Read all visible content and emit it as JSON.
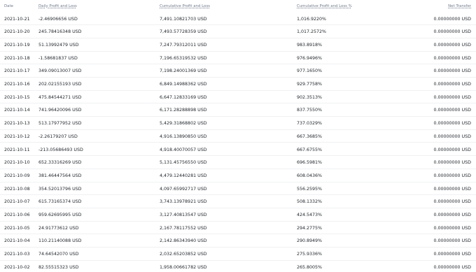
{
  "columns": {
    "date": "Date",
    "daily_pnl": "Daily Profit and Loss",
    "cumulative_pnl": "Cumulative Profit and Loss",
    "cumulative_pnl_pct": "Cumulative Profit and Loss %",
    "net_transfer": "Net Transfer"
  },
  "rows": [
    {
      "date": "2021-10-21",
      "daily": "-2.46906656 USD",
      "cumulative": "7,491.10821703 USD",
      "pct": "1,016.9220%",
      "net": "0.00000000 USD"
    },
    {
      "date": "2021-10-20",
      "daily": "245.78416348 USD",
      "cumulative": "7,493.57728359 USD",
      "pct": "1,017.2572%",
      "net": "0.00000000 USD"
    },
    {
      "date": "2021-10-19",
      "daily": "51.13992479 USD",
      "cumulative": "7,247.79312011 USD",
      "pct": "983.8918%",
      "net": "0.00000000 USD"
    },
    {
      "date": "2021-10-18",
      "daily": "-1.58681837 USD",
      "cumulative": "7,196.65319532 USD",
      "pct": "976.9496%",
      "net": "0.00000000 USD"
    },
    {
      "date": "2021-10-17",
      "daily": "349.09013007 USD",
      "cumulative": "7,198.24001369 USD",
      "pct": "977.1650%",
      "net": "0.00000000 USD"
    },
    {
      "date": "2021-10-16",
      "daily": "202.02155193 USD",
      "cumulative": "6,849.14988362 USD",
      "pct": "929.7758%",
      "net": "0.00000000 USD"
    },
    {
      "date": "2021-10-15",
      "daily": "475.84544271 USD",
      "cumulative": "6,647.12833169 USD",
      "pct": "902.3513%",
      "net": "0.00000000 USD"
    },
    {
      "date": "2021-10-14",
      "daily": "741.96420096 USD",
      "cumulative": "6,171.28288898 USD",
      "pct": "837.7550%",
      "net": "0.00000000 USD"
    },
    {
      "date": "2021-10-13",
      "daily": "513.17977952 USD",
      "cumulative": "5,429.31868802 USD",
      "pct": "737.0329%",
      "net": "0.00000000 USD"
    },
    {
      "date": "2021-10-12",
      "daily": "-2.26179207 USD",
      "cumulative": "4,916.13890850 USD",
      "pct": "667.3685%",
      "net": "0.00000000 USD"
    },
    {
      "date": "2021-10-11",
      "daily": "-213.05686493 USD",
      "cumulative": "4,918.40070057 USD",
      "pct": "667.6755%",
      "net": "0.00000000 USD"
    },
    {
      "date": "2021-10-10",
      "daily": "652.33316269 USD",
      "cumulative": "5,131.45756550 USD",
      "pct": "696.5981%",
      "net": "0.00000000 USD"
    },
    {
      "date": "2021-10-09",
      "daily": "381.46447564 USD",
      "cumulative": "4,479.12440281 USD",
      "pct": "608.0436%",
      "net": "0.00000000 USD"
    },
    {
      "date": "2021-10-08",
      "daily": "354.52013796 USD",
      "cumulative": "4,097.65992717 USD",
      "pct": "556.2595%",
      "net": "0.00000000 USD"
    },
    {
      "date": "2021-10-07",
      "daily": "615.73165374 USD",
      "cumulative": "3,743.13978921 USD",
      "pct": "508.1332%",
      "net": "0.00000000 USD"
    },
    {
      "date": "2021-10-06",
      "daily": "959.62695995 USD",
      "cumulative": "3,127.40813547 USD",
      "pct": "424.5473%",
      "net": "0.00000000 USD"
    },
    {
      "date": "2021-10-05",
      "daily": "24.91773612 USD",
      "cumulative": "2,167.78117552 USD",
      "pct": "294.2775%",
      "net": "0.00000000 USD"
    },
    {
      "date": "2021-10-04",
      "daily": "110.21140088 USD",
      "cumulative": "2,142.86343940 USD",
      "pct": "290.8949%",
      "net": "0.00000000 USD"
    },
    {
      "date": "2021-10-03",
      "daily": "74.64542070 USD",
      "cumulative": "2,032.65203852 USD",
      "pct": "275.9336%",
      "net": "0.00000000 USD"
    },
    {
      "date": "2021-10-02",
      "daily": "82.55515323 USD",
      "cumulative": "1,958.00661782 USD",
      "pct": "265.8005%",
      "net": "0.00000000 USD"
    }
  ]
}
